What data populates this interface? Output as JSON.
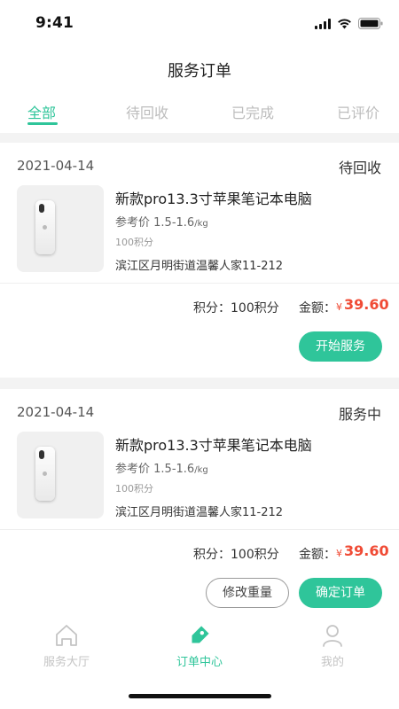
{
  "status_bar": {
    "time": "9:41"
  },
  "header": {
    "title": "服务订单"
  },
  "tabs": [
    {
      "label": "全部",
      "active": true
    },
    {
      "label": "待回收",
      "active": false
    },
    {
      "label": "已完成",
      "active": false
    },
    {
      "label": "已评价",
      "active": false
    }
  ],
  "orders": [
    {
      "date": "2021-04-14",
      "status": "待回收",
      "product_name": "新款pro13.3寸苹果笔记本电脑",
      "price_prefix": "参考价",
      "price_range": "1.5-1.6",
      "price_unit": "/kg",
      "points_line": "100积分",
      "address": "滨江区月明街道温馨人家11-212",
      "points_label": "积分：",
      "points_value": "100积分",
      "amount_label": "金额：",
      "currency": "¥",
      "amount": "39.60",
      "primary_button": "开始服务"
    },
    {
      "date": "2021-04-14",
      "status": "服务中",
      "product_name": "新款pro13.3寸苹果笔记本电脑",
      "price_prefix": "参考价",
      "price_range": "1.5-1.6",
      "price_unit": "/kg",
      "points_line": "100积分",
      "address": "滨江区月明街道温馨人家11-212",
      "points_label": "积分：",
      "points_value": "100积分",
      "amount_label": "金额：",
      "currency": "¥",
      "amount": "39.60",
      "secondary_button": "修改重量",
      "primary_button": "确定订单"
    }
  ],
  "tabbar": [
    {
      "label": "服务大厅",
      "icon": "home-icon",
      "active": false
    },
    {
      "label": "订单中心",
      "icon": "tag-icon",
      "active": true
    },
    {
      "label": "我的",
      "icon": "user-icon",
      "active": false
    }
  ],
  "colors": {
    "accent": "#2fc59a",
    "price": "#f04b35",
    "inactive": "#bdbdbd"
  }
}
